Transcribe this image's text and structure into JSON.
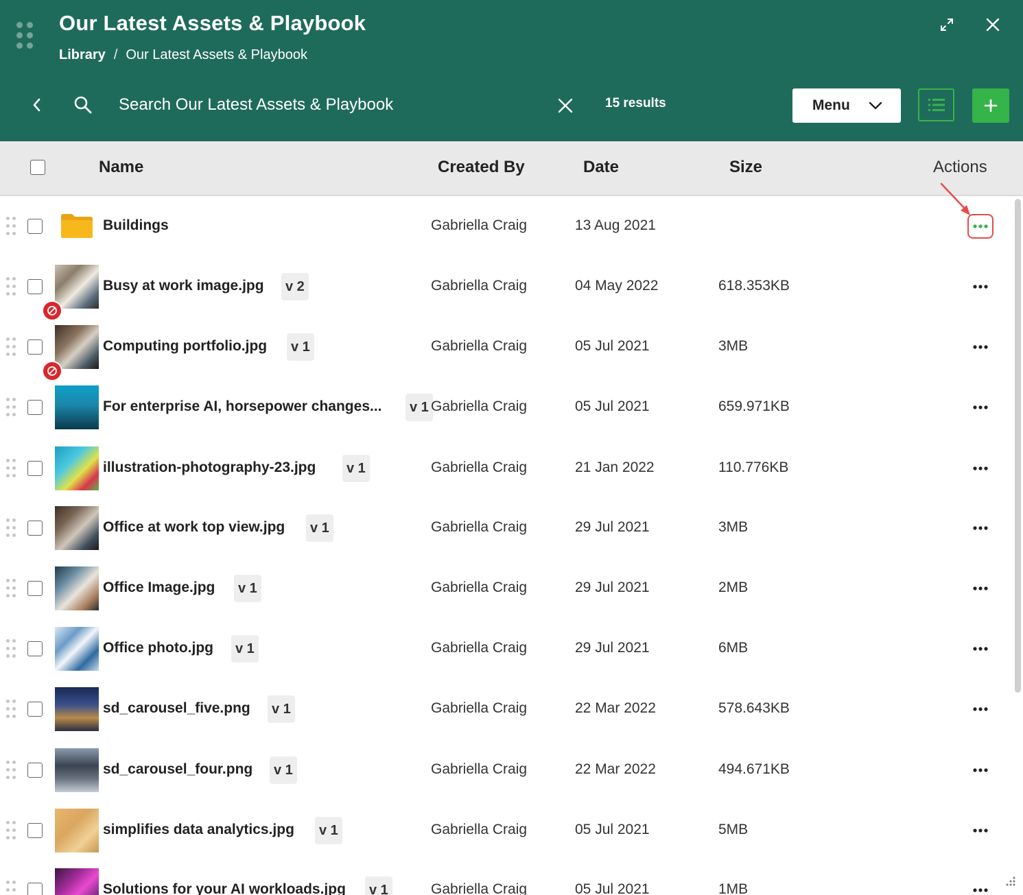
{
  "header": {
    "title": "Our Latest Assets & Playbook",
    "breadcrumb": {
      "root": "Library",
      "separator": "/",
      "current": "Our Latest Assets & Playbook"
    },
    "search_placeholder": "Search Our Latest Assets & Playbook",
    "results": "15 results",
    "menu_label": "Menu",
    "icons": {
      "drag": "drag-grip-icon",
      "expand": "expand-icon",
      "close": "close-icon",
      "back": "chevron-left-icon",
      "search": "search-icon",
      "clear": "clear-icon",
      "list": "list-view-icon",
      "add": "plus-icon"
    }
  },
  "columns": {
    "name": "Name",
    "created_by": "Created By",
    "date": "Date",
    "size": "Size",
    "actions": "Actions"
  },
  "colors": {
    "header_bg": "#1f6b5b",
    "accent_green": "#35b449",
    "blocked_red": "#d9272e",
    "highlight_red": "#e84a4a"
  },
  "rows": [
    {
      "type": "folder",
      "name": "Buildings",
      "version": "",
      "created_by": "Gabriella Craig",
      "date": "13 Aug 2021",
      "size": "",
      "blocked": false,
      "highlighted": true
    },
    {
      "type": "file",
      "name": "Busy at work image.jpg",
      "version": "v 2",
      "created_by": "Gabriella Craig",
      "date": "04 May 2022",
      "size": "618.353KB",
      "blocked": true,
      "highlighted": false
    },
    {
      "type": "file",
      "name": "Computing portfolio.jpg",
      "version": "v 1",
      "created_by": "Gabriella Craig",
      "date": "05 Jul 2021",
      "size": "3MB",
      "blocked": true,
      "highlighted": false
    },
    {
      "type": "file",
      "name": "For enterprise AI, horsepower changes...",
      "version": "v 1",
      "created_by": "Gabriella Craig",
      "date": "05 Jul 2021",
      "size": "659.971KB",
      "blocked": false,
      "highlighted": false
    },
    {
      "type": "file",
      "name": "illustration-photography-23.jpg",
      "version": "v 1",
      "created_by": "Gabriella Craig",
      "date": "21 Jan 2022",
      "size": "110.776KB",
      "blocked": false,
      "highlighted": false
    },
    {
      "type": "file",
      "name": "Office at work top view.jpg",
      "version": "v 1",
      "created_by": "Gabriella Craig",
      "date": "29 Jul 2021",
      "size": "3MB",
      "blocked": false,
      "highlighted": false
    },
    {
      "type": "file",
      "name": "Office Image.jpg",
      "version": "v 1",
      "created_by": "Gabriella Craig",
      "date": "29 Jul 2021",
      "size": "2MB",
      "blocked": false,
      "highlighted": false
    },
    {
      "type": "file",
      "name": "Office photo.jpg",
      "version": "v 1",
      "created_by": "Gabriella Craig",
      "date": "29 Jul 2021",
      "size": "6MB",
      "blocked": false,
      "highlighted": false
    },
    {
      "type": "file",
      "name": "sd_carousel_five.png",
      "version": "v 1",
      "created_by": "Gabriella Craig",
      "date": "22 Mar 2022",
      "size": "578.643KB",
      "blocked": false,
      "highlighted": false
    },
    {
      "type": "file",
      "name": "sd_carousel_four.png",
      "version": "v 1",
      "created_by": "Gabriella Craig",
      "date": "22 Mar 2022",
      "size": "494.671KB",
      "blocked": false,
      "highlighted": false
    },
    {
      "type": "file",
      "name": "simplifies data analytics.jpg",
      "version": "v 1",
      "created_by": "Gabriella Craig",
      "date": "05 Jul 2021",
      "size": "5MB",
      "blocked": false,
      "highlighted": false
    },
    {
      "type": "file",
      "name": "Solutions for your AI workloads.jpg",
      "version": "v 1",
      "created_by": "Gabriella Craig",
      "date": "05 Jul 2021",
      "size": "1MB",
      "blocked": false,
      "highlighted": false
    }
  ]
}
